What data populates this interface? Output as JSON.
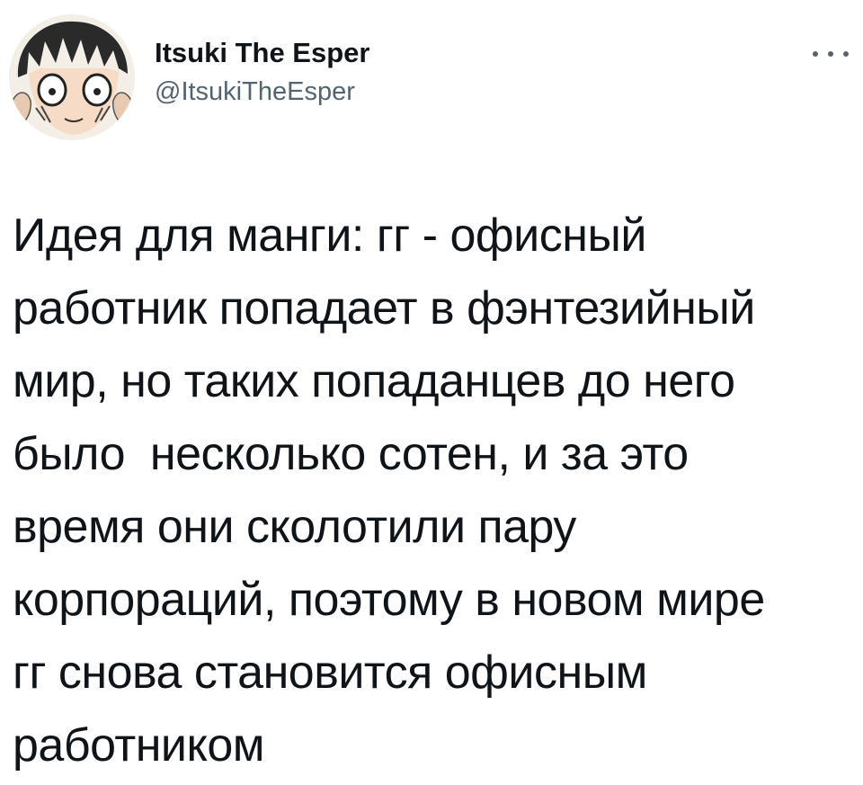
{
  "author": {
    "display_name": "Itsuki The Esper",
    "handle": "@ItsukiTheEsper",
    "avatar_icon": "anime-character-avatar"
  },
  "more_icon": "more-horizontal-icon",
  "tweet": {
    "lines": [
      "Идея для манги: гг - офисный",
      "работник попадает в фэнтезийный",
      "мир, но таких попаданцев до него",
      "было  несколько сотен, и за это",
      "время они сколотили пару",
      "корпораций, поэтому в новом мире",
      "гг снова становится офисным",
      "работником"
    ]
  },
  "colors": {
    "text_primary": "#0f1419",
    "text_secondary": "#536471",
    "background": "#ffffff"
  }
}
